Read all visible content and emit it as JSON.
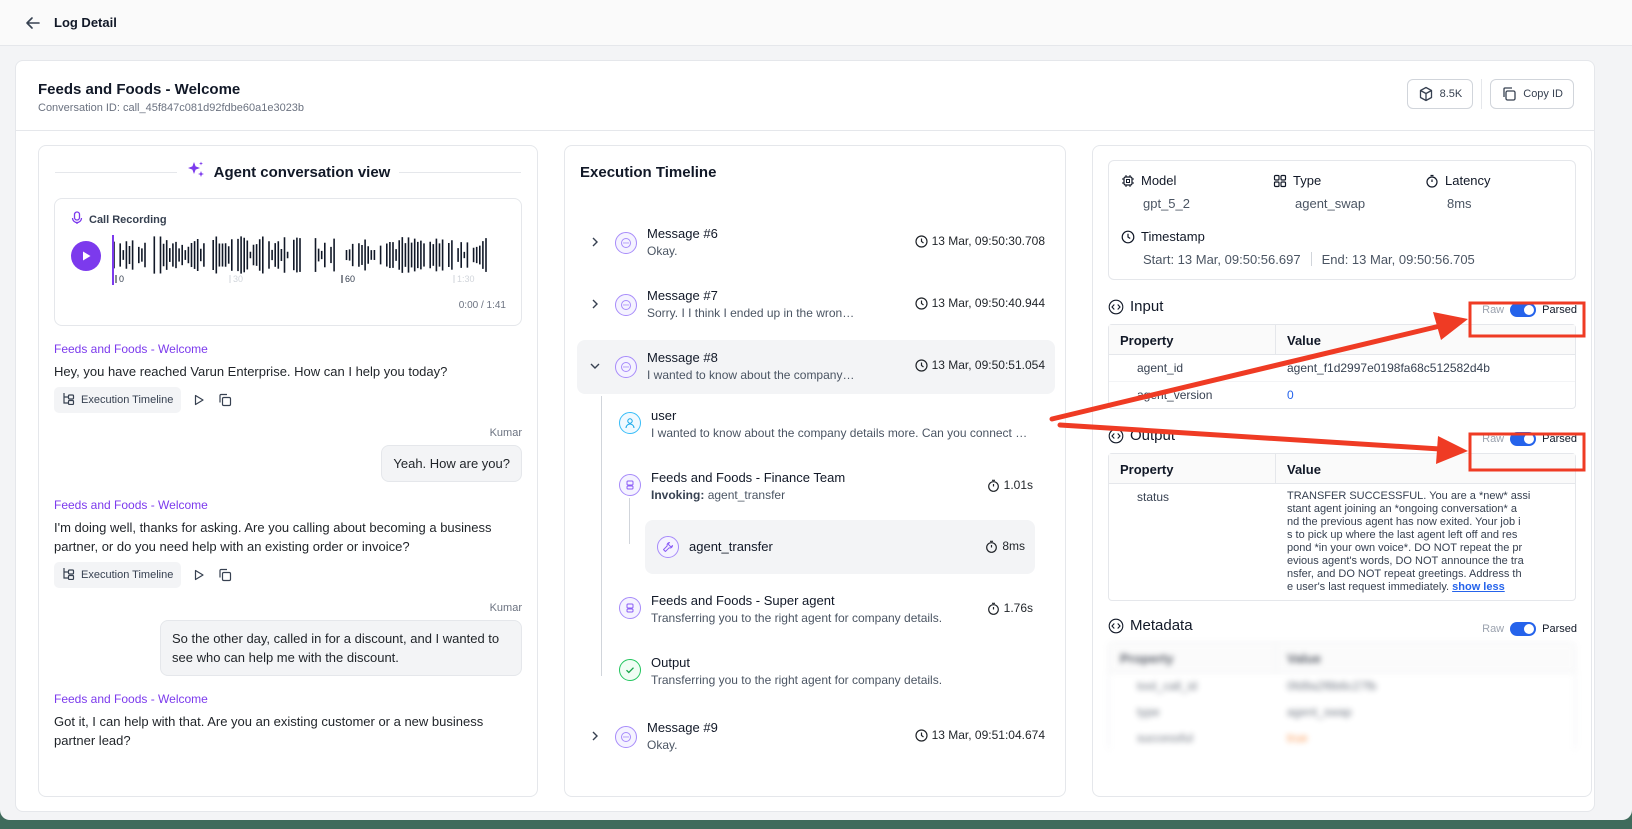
{
  "topbar": {
    "title": "Log Detail"
  },
  "header": {
    "title": "Feeds and Foods - Welcome",
    "conversation_id": "Conversation ID: call_45f847c081d92fdbe60a1e3023b",
    "tokens_label": "8.5K",
    "copy_label": "Copy ID"
  },
  "left": {
    "section_title": "Agent conversation view",
    "recording": {
      "label": "Call Recording",
      "ticks": [
        "0",
        "30",
        "60",
        "1:30"
      ],
      "time": "0:00 / 1:41",
      "progress": 0
    },
    "messages": [
      {
        "role": "agent",
        "name": "Feeds and Foods - Welcome",
        "text": "Hey, you have reached Varun Enterprise. How can I help you today?",
        "action": "Execution Timeline"
      },
      {
        "role": "user",
        "name": "Kumar",
        "text": "Yeah. How are you?"
      },
      {
        "role": "agent",
        "name": "Feeds and Foods - Welcome",
        "text": "I'm doing well, thanks for asking. Are you calling about becoming a business partner, or do you need help with an existing order or invoice?",
        "action": "Execution Timeline"
      },
      {
        "role": "user",
        "name": "Kumar",
        "text": "So the other day, called in for a discount, and I wanted to see who can help me with the discount."
      },
      {
        "role": "agent",
        "name": "Feeds and Foods - Welcome",
        "text": "Got it, I can help with that. Are you an existing customer or a new business partner lead?"
      }
    ]
  },
  "mid": {
    "title": "Execution Timeline",
    "items": [
      {
        "title": "Message #6",
        "sub": "Okay.",
        "time": "13 Mar, 09:50:30.708"
      },
      {
        "title": "Message #7",
        "sub": "Sorry. I I think I ended up in the wrong department.",
        "time": "13 Mar, 09:50:40.944"
      },
      {
        "title": "Message #8",
        "sub": "I wanted to know about the company details more.",
        "time": "13 Mar, 09:50:51.054"
      },
      {
        "title": "Message #9",
        "sub": "Okay.",
        "time": "13 Mar, 09:51:04.674"
      }
    ],
    "children": {
      "user": {
        "title": "user",
        "sub": "I wanted to know about the company details more. Can you connect me?"
      },
      "finance": {
        "title": "Feeds and Foods - Finance Team",
        "invoking_label": "Invoking:",
        "invoking_value": "agent_transfer",
        "duration": "1.01s"
      },
      "tool": {
        "title": "agent_transfer",
        "duration": "8ms"
      },
      "super": {
        "title": "Feeds and Foods - Super agent",
        "sub": "Transferring you to the right agent for company details.",
        "duration": "1.76s"
      },
      "output": {
        "title": "Output",
        "sub": "Transferring you to the right agent for company details."
      }
    }
  },
  "right": {
    "model_label": "Model",
    "model_value": "gpt_5_2",
    "type_label": "Type",
    "type_value": "agent_swap",
    "latency_label": "Latency",
    "latency_value": "8ms",
    "timestamp_label": "Timestamp",
    "start": "Start: 13 Mar, 09:50:56.697",
    "end": "End: 13 Mar, 09:50:56.705",
    "raw_label": "Raw",
    "parsed_label": "Parsed",
    "property_header": "Property",
    "value_header": "Value",
    "input": {
      "title": "Input",
      "rows": [
        {
          "k": "agent_id",
          "v": "agent_f1d2997e0198fa68c512582d4b"
        },
        {
          "k": "agent_version",
          "v": "0"
        }
      ]
    },
    "output": {
      "title": "Output",
      "key": "status",
      "lines": [
        "TRANSFER SUCCESSFUL. You are a *new* assi",
        "stant agent joining an *ongoing conversation* a",
        "nd the previous agent has now exited. Your job i",
        "s to pick up where the last agent left off and res",
        "pond *in your own voice*. DO NOT repeat the pr",
        "evious agent's words, DO NOT announce the tra",
        "nsfer, and DO NOT repeat greetings. Address th",
        "e user's last request immediately."
      ],
      "show_less": "show less"
    },
    "metadata": {
      "title": "Metadata",
      "rows": [
        {
          "k": "tool_call_id",
          "v": "0fd9a2f8b6c27fb"
        },
        {
          "k": "type",
          "v": "agent_swap"
        },
        {
          "k": "successful",
          "v": "true"
        }
      ]
    }
  },
  "colors": {
    "accent": "#7c3aed",
    "toggle": "#2563eb",
    "annotation": "#ef3b24"
  }
}
